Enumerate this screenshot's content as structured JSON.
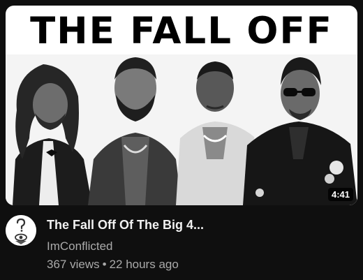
{
  "thumbnail": {
    "headline": "THE FALL OFF",
    "duration": "4:41",
    "subjects": [
      "person-dreadlocks-tuxedo",
      "person-beard-suit",
      "person-open-shirt",
      "person-sunglasses-brooch"
    ]
  },
  "channel": {
    "avatar_icon": "question-mark-eye-icon",
    "name": "ImConflicted"
  },
  "video": {
    "title": "The Fall Off Of The Big 4...",
    "views": "367 views",
    "separator": "•",
    "age": "22 hours ago"
  },
  "colors": {
    "background": "#0f0f0f",
    "title_text": "#f1f1f1",
    "secondary_text": "#aaaaaa"
  }
}
